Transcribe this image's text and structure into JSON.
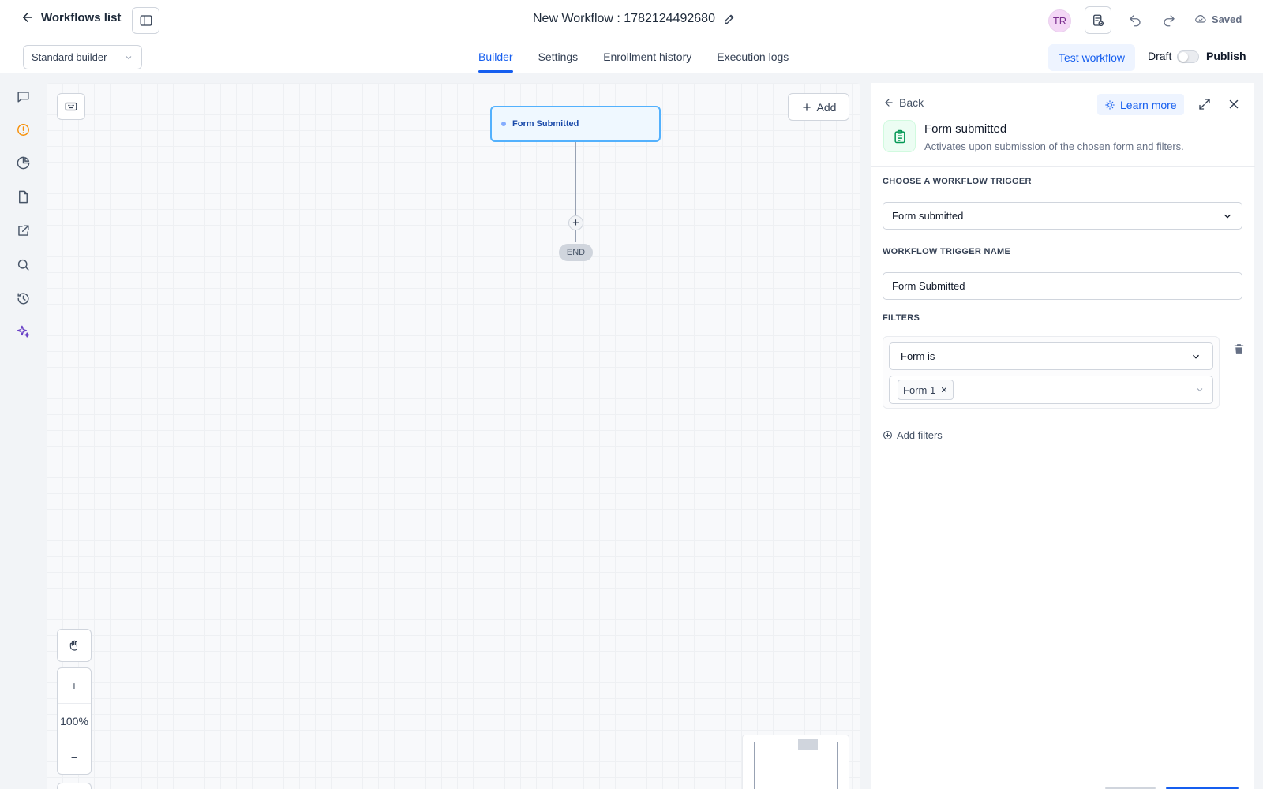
{
  "header": {
    "back_label": "Workflows list",
    "workflow_title": "New Workflow : 1782124492680",
    "avatar_initials": "TR",
    "status": "Saved"
  },
  "subbar": {
    "builder_mode": "Standard builder",
    "tabs": [
      {
        "label": "Builder",
        "active": true
      },
      {
        "label": "Settings",
        "active": false
      },
      {
        "label": "Enrollment history",
        "active": false
      },
      {
        "label": "Execution logs",
        "active": false
      }
    ],
    "test_label": "Test workflow",
    "draft_label": "Draft",
    "publish_label": "Publish",
    "publish_on": false
  },
  "rail": {
    "icons": [
      "chat-icon",
      "alert-icon",
      "pie-chart-icon",
      "document-icon",
      "external-link-icon",
      "search-icon",
      "history-icon",
      "sparkle-icon"
    ]
  },
  "canvas": {
    "add_label": "Add",
    "trigger_node_label": "Form Submitted",
    "end_label": "END",
    "zoom_in": "+",
    "zoom_level": "100%",
    "zoom_out": "−"
  },
  "panel": {
    "back_label": "Back",
    "learn_more_label": "Learn more",
    "trigger_title": "Form submitted",
    "trigger_description": "Activates upon submission of the chosen form and filters.",
    "choose_trigger_label": "CHOOSE A WORKFLOW TRIGGER",
    "choose_trigger_value": "Form submitted",
    "trigger_name_label": "WORKFLOW TRIGGER NAME",
    "trigger_name_value": "Form Submitted",
    "filters_label": "FILTERS",
    "filter_condition": "Form is",
    "filter_chip": "Form 1",
    "add_filters_label": "Add filters"
  },
  "colors": {
    "accent": "#155eef",
    "node_border": "#53b1fd",
    "node_bg": "#eff8ff",
    "alert": "#f79009",
    "sparkle": "#6941c6"
  }
}
